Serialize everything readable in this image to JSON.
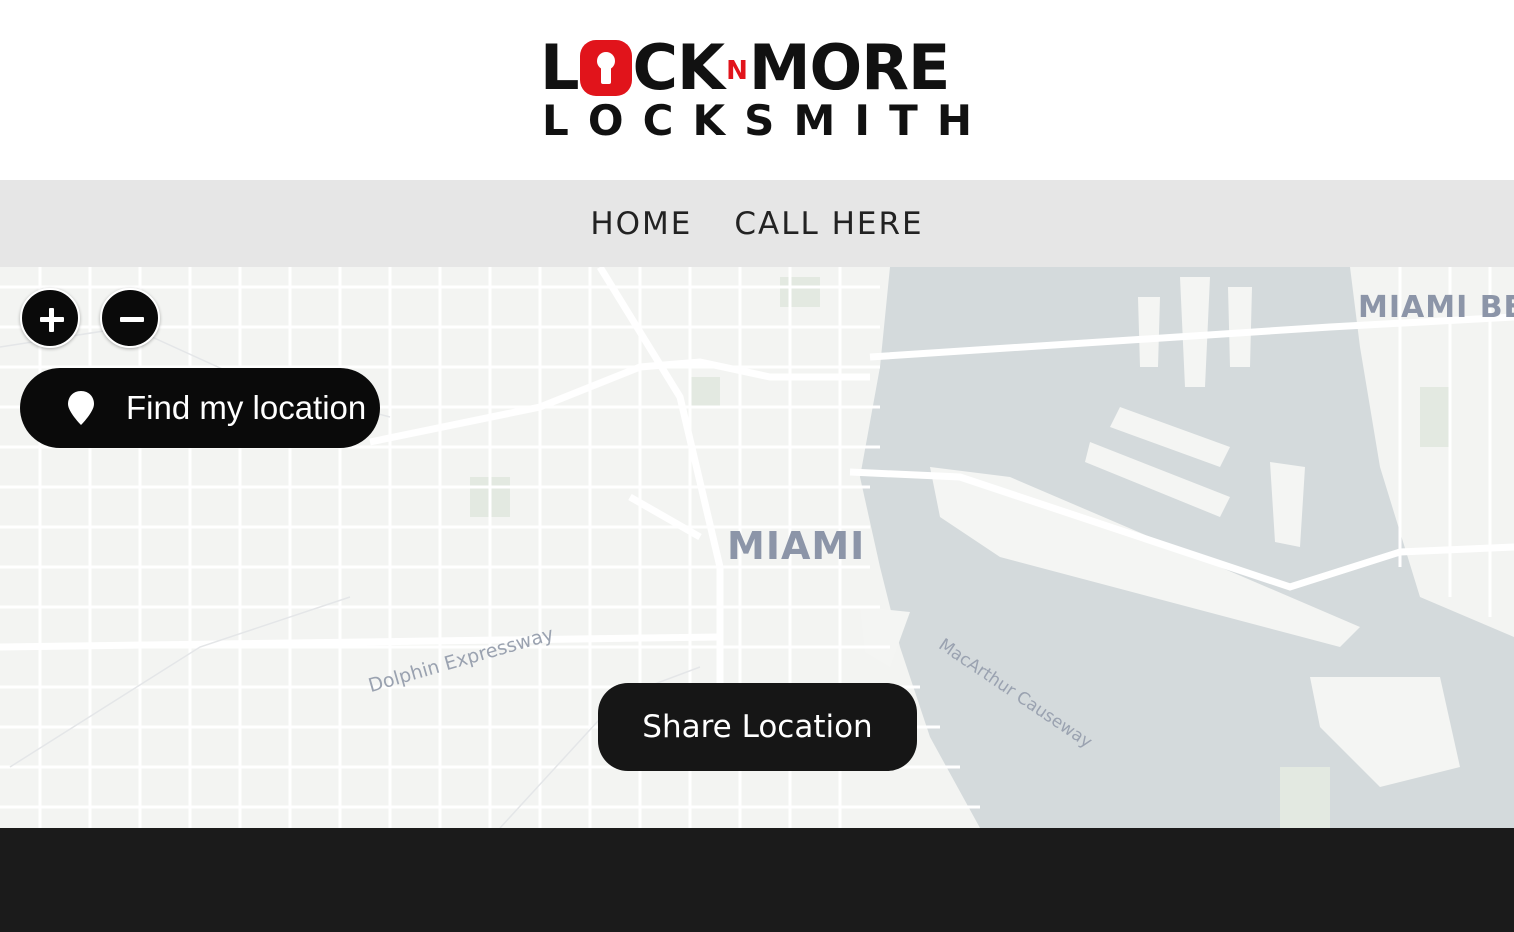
{
  "header": {
    "logo": {
      "line1_left": "L",
      "line1_mid": "CK",
      "line1_n": "N",
      "line1_right": "MORE",
      "line2": [
        "L",
        "O",
        "C",
        "K",
        "S",
        "M",
        "I",
        "T",
        "H"
      ]
    }
  },
  "nav": {
    "items": [
      {
        "label": "HOME"
      },
      {
        "label": "CALL HERE"
      }
    ]
  },
  "map": {
    "labels": {
      "city": "MIAMI",
      "beach": "MIAMI BE",
      "dolphin": "Dolphin Expressway",
      "macarthur": "MacArthur Causeway"
    },
    "controls": {
      "zoom_in_icon": "plus-icon",
      "zoom_out_icon": "minus-icon",
      "find_location_label": "Find my location",
      "find_location_icon": "map-pin-icon"
    },
    "share_label": "Share Location",
    "colors": {
      "water": "#d4dadc",
      "land": "#f3f4f2",
      "road": "#ffffff",
      "park": "#e3e9e1"
    }
  },
  "colors": {
    "brand_red": "#e1141b",
    "nav_bg": "#e6e6e6",
    "button_bg": "#0a0a0a",
    "footer_bg": "#1b1b1b"
  }
}
